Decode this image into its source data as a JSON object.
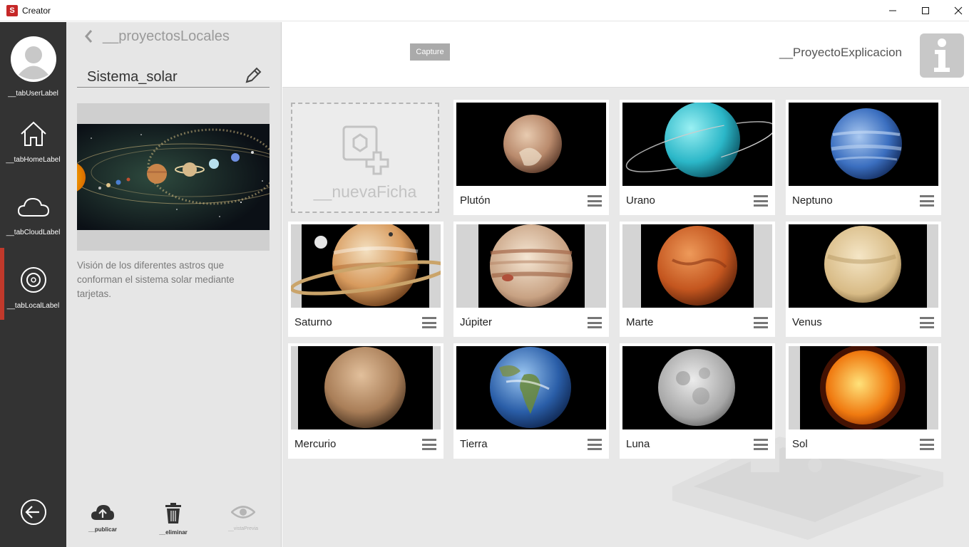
{
  "window": {
    "title": "Creator",
    "icon_letter": "S"
  },
  "sidebar": {
    "tabs": [
      {
        "label": "__tabUserLabel"
      },
      {
        "label": "__tabHomeLabel"
      },
      {
        "label": "__tabCloudLabel"
      },
      {
        "label": "__tabLocalLabel"
      }
    ],
    "active_tab": "__tabLocalLabel",
    "accent_color": "#c0392b"
  },
  "panel": {
    "back_label": "__proyectosLocales",
    "project_name": "Sistema_solar",
    "description": "Visión de los diferentes astros que conforman el sistema solar mediante tarjetas.",
    "actions": [
      {
        "label": "__publicar",
        "icon": "cloud-upload-icon"
      },
      {
        "label": "__eliminar",
        "icon": "trash-icon"
      },
      {
        "label": "__vistaPrevia",
        "icon": "eye-icon"
      }
    ]
  },
  "header": {
    "capture_label": "Capture",
    "project_explanation": "__ProyectoExplicacion",
    "info_icon": "info-icon"
  },
  "grid": {
    "new_card_label": "__nuevaFicha",
    "cards": [
      {
        "name": "Plutón"
      },
      {
        "name": "Urano"
      },
      {
        "name": "Neptuno"
      },
      {
        "name": "Saturno"
      },
      {
        "name": "Júpiter"
      },
      {
        "name": "Marte"
      },
      {
        "name": "Venus"
      },
      {
        "name": "Mercurio"
      },
      {
        "name": "Tierra"
      },
      {
        "name": "Luna"
      },
      {
        "name": "Sol"
      }
    ]
  }
}
